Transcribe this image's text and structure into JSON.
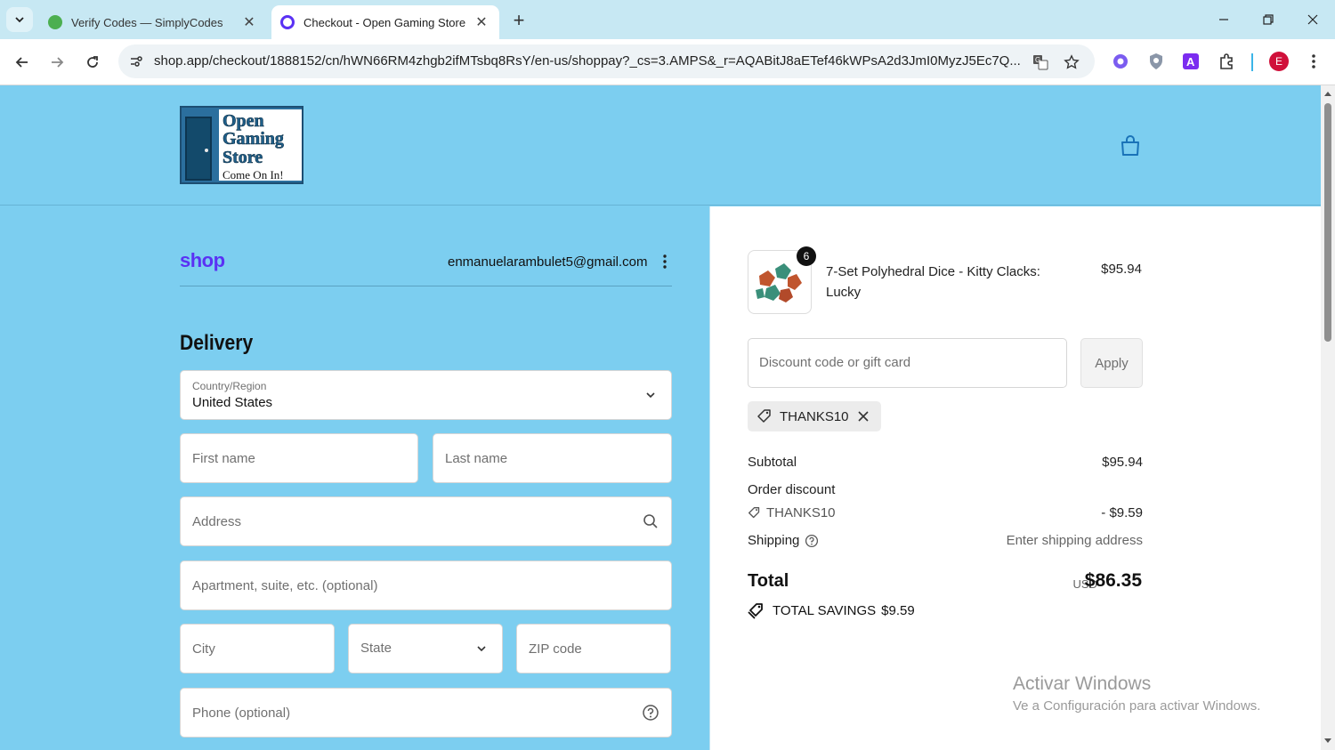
{
  "browser": {
    "tabs": [
      {
        "title": "Verify Codes — SimplyCodes",
        "active": false
      },
      {
        "title": "Checkout - Open Gaming Store",
        "active": true
      }
    ],
    "url": "shop.app/checkout/1888152/cn/hWN66RM4zhgb2ifMTsbq8RsY/en-us/shoppay?_cs=3.AMPS&_r=AQABitJ8aETef46kWPsA2d3JmI0MyzJ5Ec7Q...",
    "profile_initial": "E",
    "colors": {
      "tabbar": "#c7e8f3",
      "accent": "#5a31f4"
    }
  },
  "store": {
    "logo_lines": [
      "Open",
      "Gaming",
      "Store",
      "Come On In!"
    ]
  },
  "checkout": {
    "shop_brand": "shop",
    "email": "enmanuelarambulet5@gmail.com",
    "delivery_heading": "Delivery",
    "country": {
      "label": "Country/Region",
      "value": "United States"
    },
    "fields": {
      "first_name": "First name",
      "last_name": "Last name",
      "address": "Address",
      "apartment": "Apartment, suite, etc. (optional)",
      "city": "City",
      "state": "State",
      "zip": "ZIP code",
      "phone": "Phone (optional)"
    }
  },
  "summary": {
    "product": {
      "name": "7-Set Polyhedral Dice - Kitty Clacks: Lucky",
      "quantity": "6",
      "price": "$95.94"
    },
    "discount_placeholder": "Discount code or gift card",
    "apply_label": "Apply",
    "applied_code": "THANKS10",
    "subtotal_label": "Subtotal",
    "subtotal_value": "$95.94",
    "order_discount_label": "Order discount",
    "discount_code": "THANKS10",
    "discount_value": "- $9.59",
    "shipping_label": "Shipping",
    "shipping_value": "Enter shipping address",
    "total_label": "Total",
    "total_currency": "USD",
    "total_value": "$86.35",
    "savings_label": "TOTAL SAVINGS",
    "savings_value": "$9.59"
  },
  "watermark": {
    "line1": "Activar Windows",
    "line2": "Ve a Configuración para activar Windows."
  }
}
